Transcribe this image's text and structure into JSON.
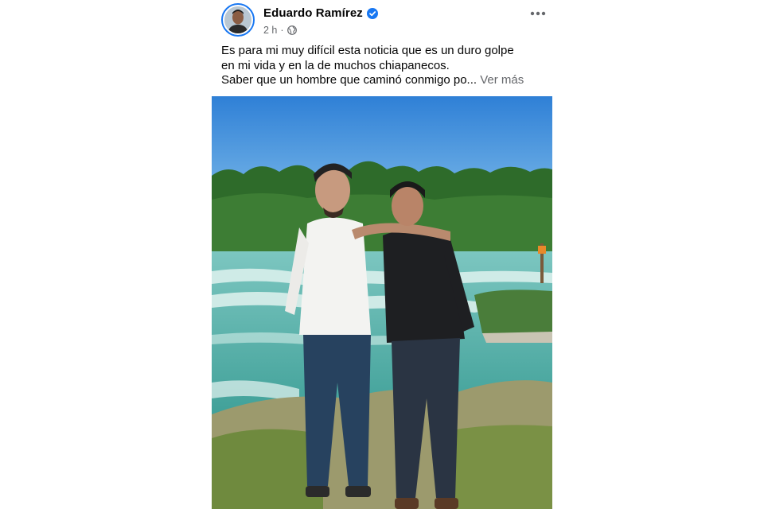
{
  "post": {
    "author": {
      "name": "Eduardo Ramírez",
      "verified": true
    },
    "timestamp": "2 h",
    "separator": "·",
    "audience_icon": "globe-icon",
    "more_icon": "ellipsis-horizontal-icon",
    "caption": {
      "lines": [
        "Es para mi muy difícil esta noticia que es un duro golpe",
        "en mi vida y en la de muchos chiapanecos.",
        "Saber que un hombre que caminó conmigo po..."
      ],
      "see_more": "Ver más"
    },
    "photo_icon": "post-photo"
  },
  "colors": {
    "verified_badge": "#1877f2",
    "avatar_ring": "#1877f2",
    "text_primary": "#050505",
    "text_secondary": "#65676b",
    "sky": "#3f8fdc",
    "river": "#5fb7ac"
  }
}
